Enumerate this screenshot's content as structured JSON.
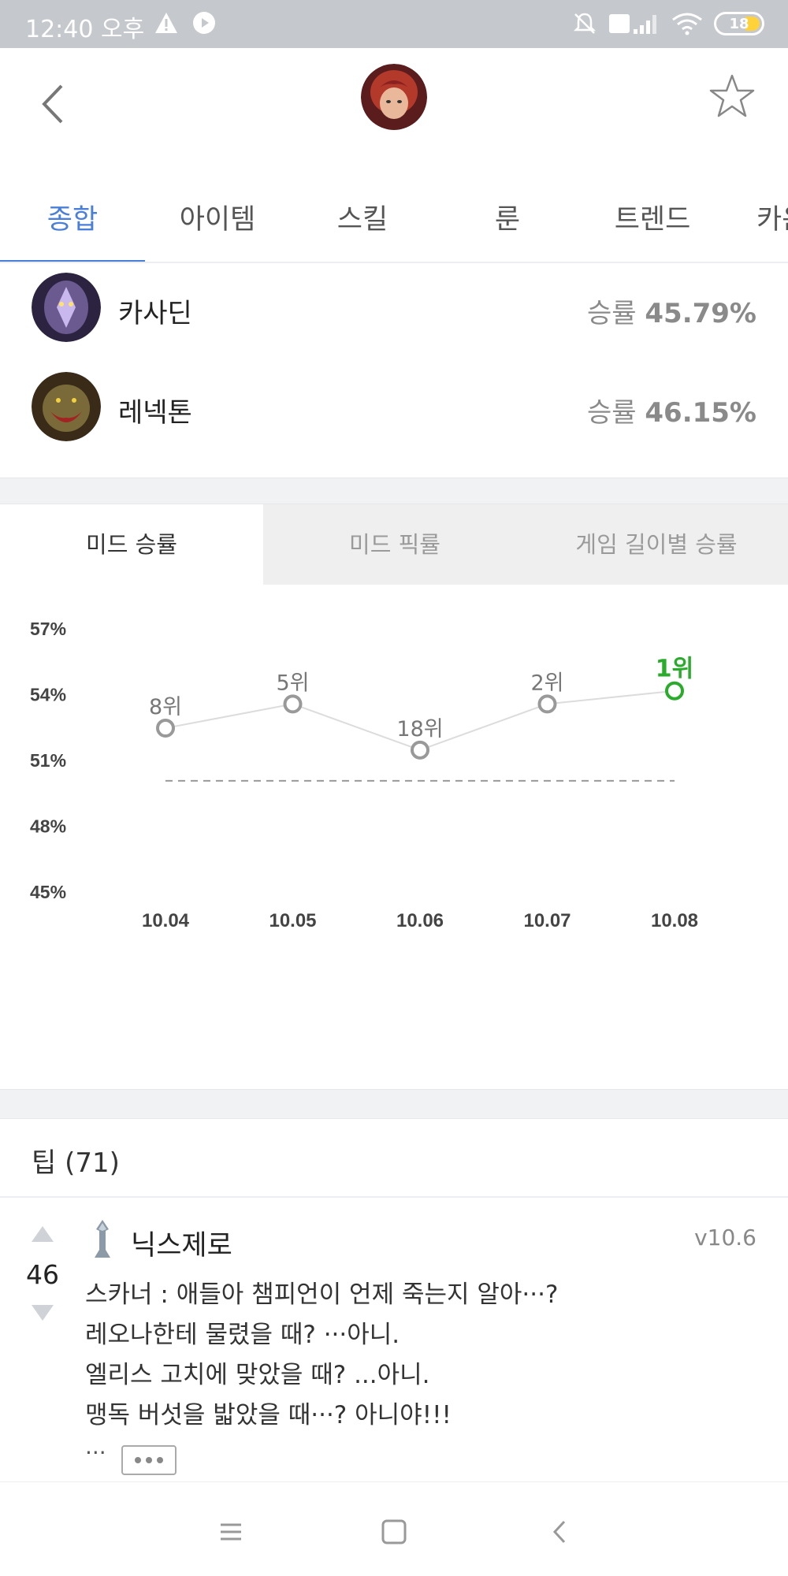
{
  "status_bar": {
    "time": "12:40 오후",
    "battery": "18"
  },
  "header": {
    "champion_icon": "annie-portrait"
  },
  "tabs": [
    {
      "label": "종합"
    },
    {
      "label": "아이템"
    },
    {
      "label": "스킬"
    },
    {
      "label": "룬"
    },
    {
      "label": "트렌드"
    },
    {
      "label": "카운"
    }
  ],
  "counters": [
    {
      "name": "카사딘",
      "rate_label": "승률",
      "rate_value": "45.79%"
    },
    {
      "name": "레넥톤",
      "rate_label": "승률",
      "rate_value": "46.15%"
    }
  ],
  "chart_tabs": [
    {
      "label": "미드 승률"
    },
    {
      "label": "미드 픽률"
    },
    {
      "label": "게임 길이별 승률"
    }
  ],
  "chart_data": {
    "type": "line",
    "title": "",
    "xlabel": "",
    "ylabel": "",
    "categories": [
      "10.04",
      "10.05",
      "10.06",
      "10.07",
      "10.08"
    ],
    "values": [
      52.4,
      53.5,
      51.4,
      53.5,
      54.1
    ],
    "ranks": [
      "8위",
      "5위",
      "18위",
      "2위",
      "1위"
    ],
    "y_ticks": [
      "57%",
      "54%",
      "51%",
      "48%",
      "45%"
    ],
    "ylim": [
      45,
      57
    ],
    "reference_line": 50,
    "highlight_color": "#2bab2b",
    "series_color": "#999999"
  },
  "tips": {
    "title": "팁 (71)",
    "items": [
      {
        "votes": "46",
        "author": "닉스제로",
        "version": "v10.6",
        "lines": [
          "스카너 : 애들아 챔피언이 언제 죽는지 알아···?",
          "레오나한테 물렸을 때? ···아니.",
          "엘리스 고치에 맞았을 때? ...아니.",
          "맹독 버섯을 밟았을 때···? 아니야!!!"
        ],
        "ellipsis": "···"
      }
    ]
  },
  "colors": {
    "accent": "#4a7fd9",
    "highlight": "#2bab2b"
  }
}
